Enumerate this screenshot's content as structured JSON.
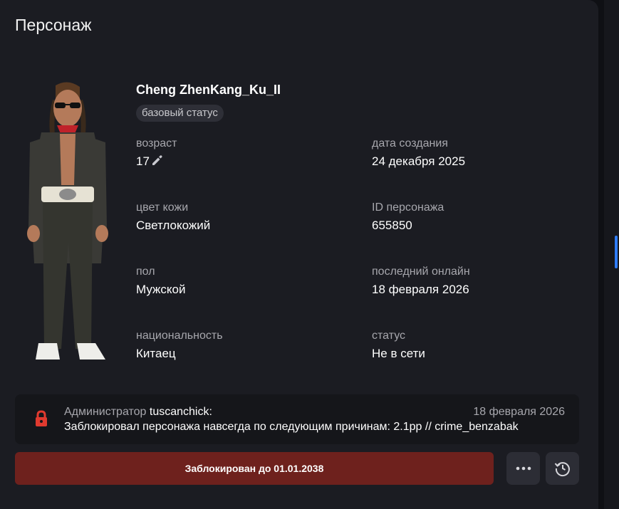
{
  "header": {
    "title": "Персонаж"
  },
  "character": {
    "name": "Cheng ZhenKang_Ku_II",
    "status_badge": "базовый статус"
  },
  "fields": {
    "age": {
      "label": "возраст",
      "value": "17"
    },
    "created": {
      "label": "дата создания",
      "value": "24 декабря 2025"
    },
    "skin": {
      "label": "цвет кожи",
      "value": "Светлокожий"
    },
    "id": {
      "label": "ID персонажа",
      "value": "655850"
    },
    "gender": {
      "label": "пол",
      "value": "Мужской"
    },
    "last_online": {
      "label": "последний онлайн",
      "value": "18 февраля 2026"
    },
    "nationality": {
      "label": "национальность",
      "value": "Китаец"
    },
    "status": {
      "label": "статус",
      "value": "Не в сети"
    }
  },
  "ban_notice": {
    "admin_prefix": "Администратор",
    "admin_name": "tuscanchick:",
    "date": "18 февраля 2026",
    "text": "Заблокировал персонажа навсегда по следующим причинам: 2.1pp // crime_benzabak"
  },
  "actions": {
    "ban_label": "Заблокирован до 01.01.2038",
    "more_icon": "more-dots-icon",
    "history_icon": "history-clock-icon"
  },
  "colors": {
    "card_bg": "#1b1c22",
    "ban_bar": "#6e211d",
    "lock": "#e03a2f",
    "accent_scroll": "#2f7cf6"
  }
}
